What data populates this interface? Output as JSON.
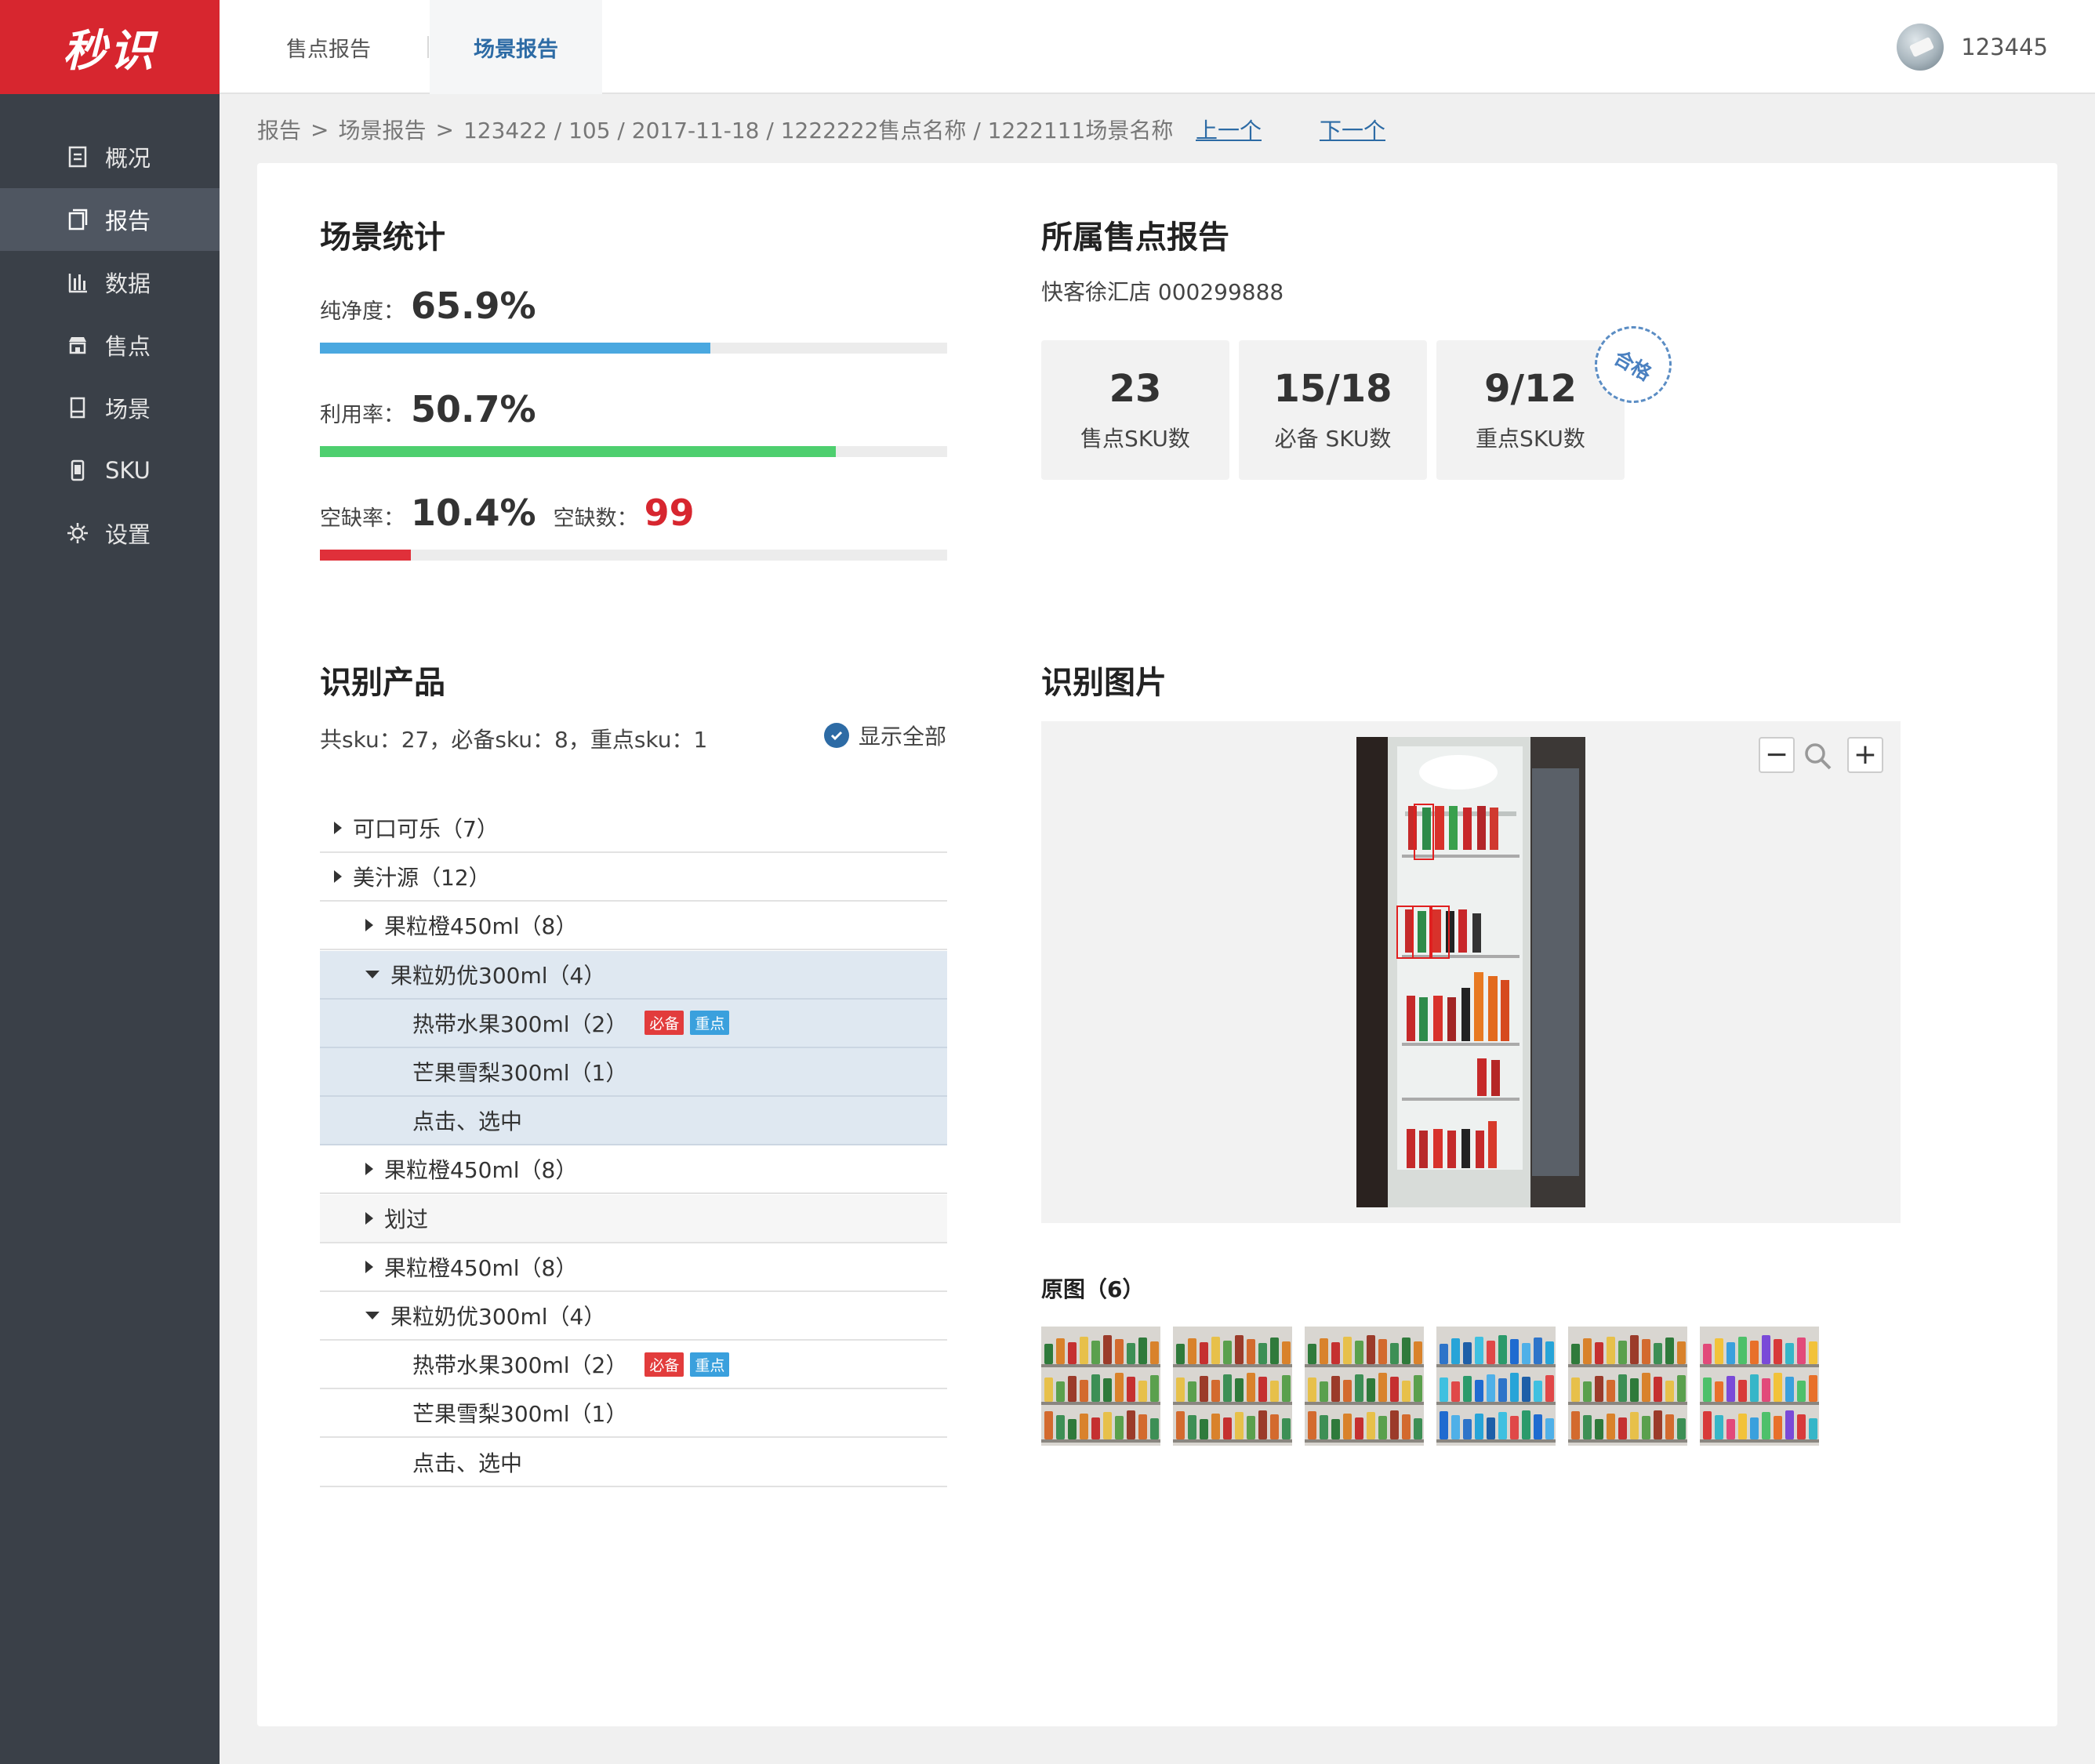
{
  "app": {
    "logo": "秒识"
  },
  "sidebar": {
    "items": [
      {
        "label": "概况",
        "icon": "overview-icon"
      },
      {
        "label": "报告",
        "icon": "report-icon",
        "active": true
      },
      {
        "label": "数据",
        "icon": "data-chart-icon"
      },
      {
        "label": "售点",
        "icon": "store-icon"
      },
      {
        "label": "场景",
        "icon": "scene-icon"
      },
      {
        "label": "SKU",
        "icon": "sku-icon"
      },
      {
        "label": "设置",
        "icon": "gear-icon"
      }
    ]
  },
  "header": {
    "tabs": [
      {
        "label": "售点报告"
      },
      {
        "label": "场景报告",
        "active": true
      }
    ],
    "user": {
      "name": "123445"
    }
  },
  "breadcrumb": {
    "items": [
      "报告",
      "场景报告"
    ],
    "path": "123422 / 105 / 2017-11-18 / 1222222售点名称 / 1222111场景名称",
    "prev": "上一个",
    "next": "下一个"
  },
  "scene_stats": {
    "title": "场景统计",
    "purity": {
      "label": "纯净度：",
      "value": "65.9%",
      "fraction": 0.622,
      "color": "#4aa8e0"
    },
    "utilization": {
      "label": "利用率：",
      "value": "50.7%",
      "fraction": 0.822,
      "color": "#4ecf6f"
    },
    "shortage": {
      "label": "空缺率：",
      "value": "10.4%",
      "fraction": 0.145,
      "color": "#e0303a"
    },
    "shortage_count": {
      "label": "空缺数：",
      "value": "99"
    }
  },
  "belong_report": {
    "title": "所属售点报告",
    "store": "快客徐汇店 000299888",
    "kpis": [
      {
        "value": "23",
        "label": "售点SKU数"
      },
      {
        "value": "15/18",
        "label": "必备 SKU数"
      },
      {
        "value": "9/12",
        "label": "重点SKU数"
      }
    ],
    "stamp": "合格"
  },
  "products": {
    "title": "识别产品",
    "summary": "共sku：27，必备sku：8，重点sku：1",
    "show_all": "显示全部",
    "rows": [
      {
        "label": "可口可乐（7）",
        "level": 0,
        "arrow": "right"
      },
      {
        "label": "美汁源（12）",
        "level": 0,
        "arrow": "right"
      },
      {
        "label": "果粒橙450ml（8）",
        "level": 1,
        "arrow": "right"
      },
      {
        "label": "果粒奶优300ml（4）",
        "level": 1,
        "arrow": "down",
        "hl": true
      },
      {
        "label": "热带水果300ml（2）",
        "level": 2,
        "tags": [
          "必备",
          "重点"
        ],
        "hl": true
      },
      {
        "label": "芒果雪梨300ml（1）",
        "level": 2,
        "hl": true
      },
      {
        "label": "点击、选中",
        "level": 2,
        "hl": true
      },
      {
        "label": "果粒橙450ml（8）",
        "level": 1,
        "arrow": "right"
      },
      {
        "label": "划过",
        "level": 1,
        "arrow": "right",
        "grey": true
      },
      {
        "label": "果粒橙450ml（8）",
        "level": 1,
        "arrow": "right"
      },
      {
        "label": "果粒奶优300ml（4）",
        "level": 1,
        "arrow": "down"
      },
      {
        "label": "热带水果300ml（2）",
        "level": 2,
        "tags": [
          "必备",
          "重点"
        ]
      },
      {
        "label": "芒果雪梨300ml（1）",
        "level": 2
      },
      {
        "label": "点击、选中",
        "level": 2
      }
    ]
  },
  "images": {
    "title": "识别图片",
    "zoom_out": "−",
    "zoom_in": "+",
    "originals_title": "原图（6）",
    "thumbnails": [
      {
        "style": "drinks"
      },
      {
        "style": "drinks"
      },
      {
        "style": "drinks"
      },
      {
        "style": "blue"
      },
      {
        "style": "drinks"
      },
      {
        "style": "bright"
      }
    ]
  }
}
